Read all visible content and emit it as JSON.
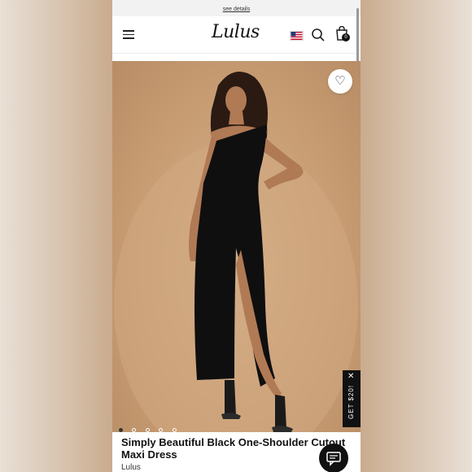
{
  "promo": {
    "link_label": "see details"
  },
  "header": {
    "logo_text": "Lulus",
    "bag_count": "0",
    "flag_country": "US"
  },
  "hero": {
    "wishlist_glyph": "♡",
    "carousel": {
      "count": 5,
      "active_index": 0
    }
  },
  "promo_tab": {
    "label": "GET $20!",
    "close_glyph": "✕"
  },
  "product": {
    "title": "Simply Beautiful Black One-Shoulder Cutout Maxi Dress",
    "brand": "Lulus"
  },
  "icons": {
    "menu": "menu-icon",
    "search": "search-icon",
    "bag": "shopping-bag-icon",
    "wishlist": "heart-icon",
    "chat": "chat-icon",
    "flag": "us-flag-icon"
  },
  "colors": {
    "accent": "#111111",
    "hero_background": "#c79c73"
  }
}
